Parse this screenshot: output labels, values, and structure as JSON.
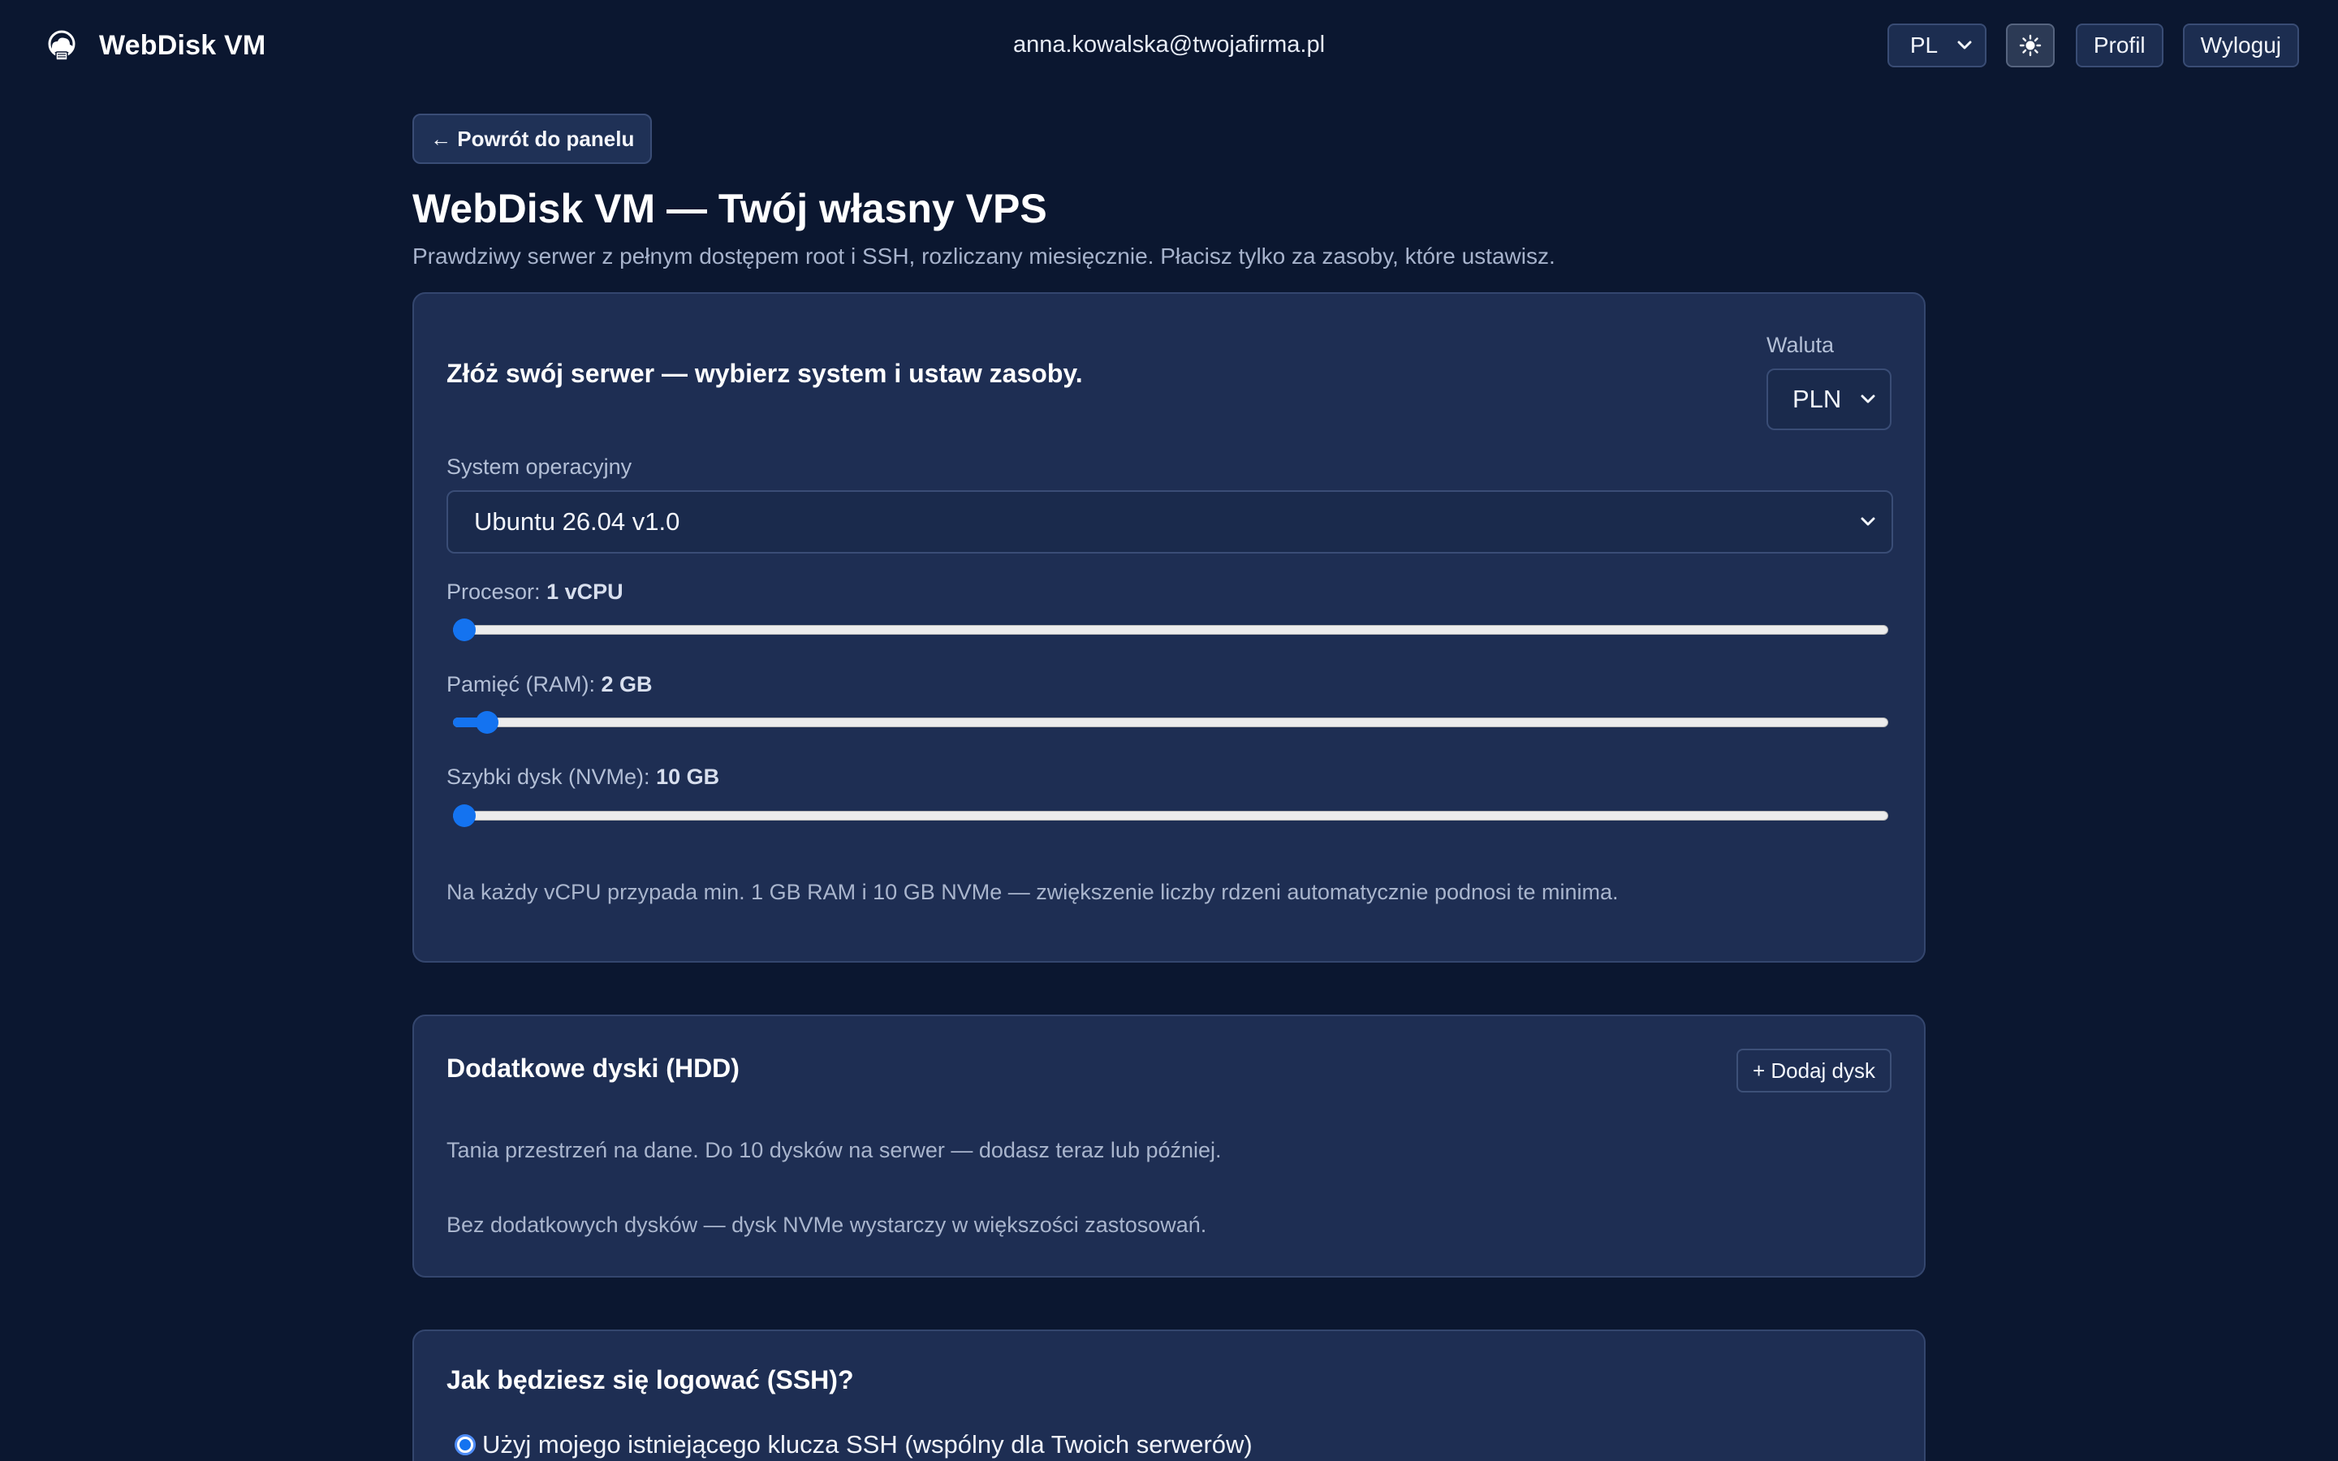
{
  "header": {
    "brand_name": "WebDisk VM",
    "user_email": "anna.kowalska@twojafirma.pl",
    "language": "PL",
    "theme_icon": "sun-icon",
    "profile_label": "Profil",
    "logout_label": "Wyloguj"
  },
  "page": {
    "back_label": "← Powrót do panelu",
    "title": "WebDisk VM — Twój własny VPS",
    "subtitle": "Prawdziwy serwer z pełnym dostępem root i SSH, rozliczany miesięcznie. Płacisz tylko za zasoby, które ustawisz."
  },
  "builder": {
    "title": "Złóż swój serwer — wybierz system i ustaw zasoby.",
    "currency_label": "Waluta",
    "currency_value": "PLN",
    "os_label": "System operacyjny",
    "os_value": "Ubuntu 26.04 v1.0",
    "cpu": {
      "label": "Procesor:",
      "value": "1 vCPU",
      "fraction": 0.0
    },
    "ram": {
      "label": "Pamięć (RAM):",
      "value": "2 GB",
      "fraction": 0.016
    },
    "nvme": {
      "label": "Szybki dysk (NVMe):",
      "value": "10 GB",
      "fraction": 0.0
    },
    "note": "Na każdy vCPU przypada min. 1 GB RAM i 10 GB NVMe — zwiększenie liczby rdzeni automatycznie podnosi te minima."
  },
  "extra_disks": {
    "title": "Dodatkowe dyski (HDD)",
    "add_label": "+ Dodaj dysk",
    "description": "Tania przestrzeń na dane. Do 10 dysków na serwer — dodasz teraz lub później.",
    "empty_text": "Bez dodatkowych dysków — dysk NVMe wystarczy w większości zastosowań."
  },
  "ssh": {
    "title": "Jak będziesz się logować (SSH)?",
    "option_existing_key": "Użyj mojego istniejącego klucza SSH (wspólny dla Twoich serwerów)"
  },
  "colors": {
    "background": "#0b1730",
    "card": "#1e2e53",
    "accent": "#1473f0"
  }
}
